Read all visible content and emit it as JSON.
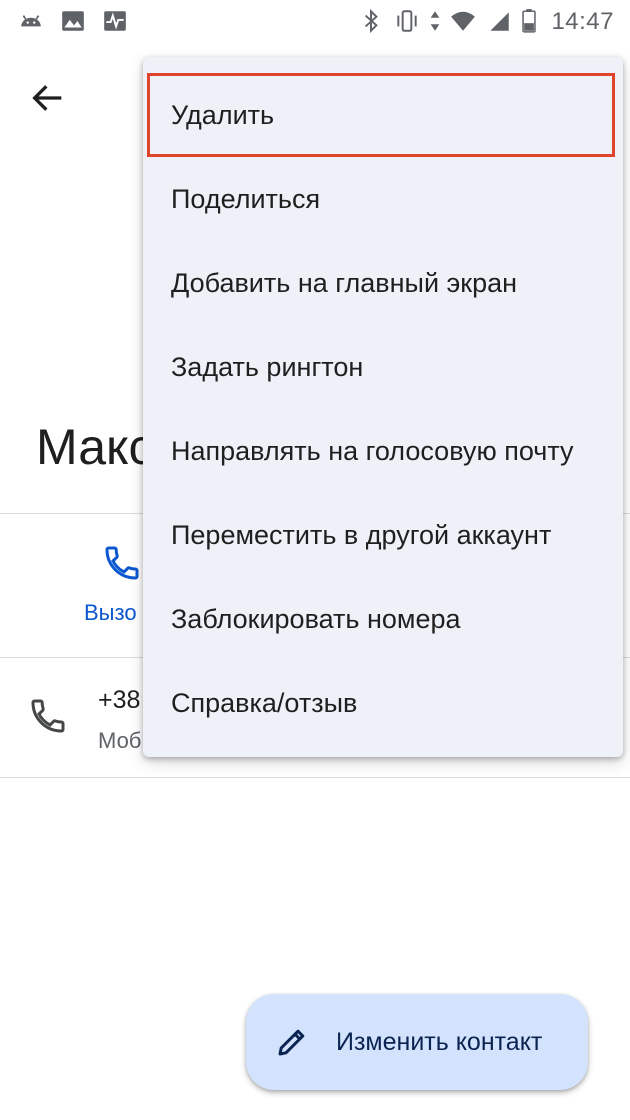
{
  "status_bar": {
    "time": "14:47",
    "left_icons": [
      "android-icon",
      "image-icon",
      "activity-monitor-icon"
    ],
    "right_icons": [
      "bluetooth-icon",
      "vibrate-icon",
      "data-transfer-icon",
      "wifi-icon",
      "no-sim-icon",
      "battery-icon"
    ]
  },
  "contact": {
    "name": "Макс",
    "call_action_label": "Вызо",
    "phone_number": "+38",
    "phone_type": "Моб"
  },
  "menu": {
    "items": [
      {
        "label": "Удалить"
      },
      {
        "label": "Поделиться"
      },
      {
        "label": "Добавить на главный экран"
      },
      {
        "label": "Задать рингтон"
      },
      {
        "label": "Направлять на голосовую почту"
      },
      {
        "label": "Переместить в другой аккаунт"
      },
      {
        "label": "Заблокировать номера"
      },
      {
        "label": "Справка/отзыв"
      }
    ],
    "highlighted_index": 0
  },
  "fab": {
    "label": "Изменить контакт",
    "icon": "pencil-icon"
  },
  "colors": {
    "accent": "#0b57d0",
    "menu_bg": "#eff1f9",
    "fab_bg": "#d3e3fd",
    "highlight_border": "#e0442d"
  }
}
